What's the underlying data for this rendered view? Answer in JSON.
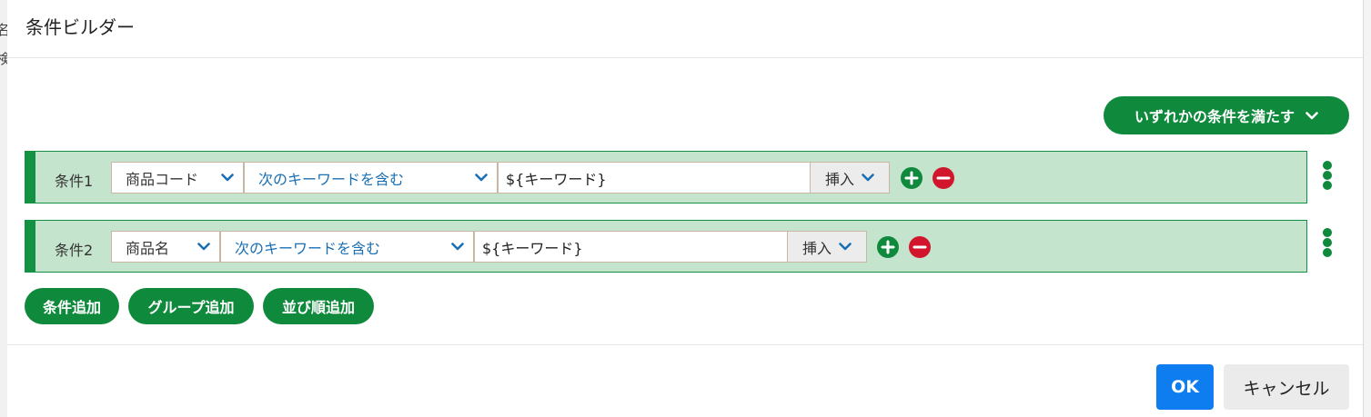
{
  "background": {
    "fragments": [
      "名",
      "検"
    ]
  },
  "dialog": {
    "title": "条件ビルダー"
  },
  "match_mode": {
    "label": "いずれかの条件を満たす"
  },
  "conditions": [
    {
      "label": "条件1",
      "field": "商品コード",
      "operator": "次のキーワードを含む",
      "value": "${キーワード}",
      "insert_label": "挿入"
    },
    {
      "label": "条件2",
      "field": "商品名",
      "operator": "次のキーワードを含む",
      "value": "${キーワード}",
      "insert_label": "挿入"
    }
  ],
  "actions": {
    "add_condition": "条件追加",
    "add_group": "グループ追加",
    "add_sort": "並び順追加"
  },
  "footer": {
    "ok": "OK",
    "cancel": "キャンセル"
  },
  "colors": {
    "green": "#0f8a3c",
    "row_bg": "#c4e4cd",
    "blue": "#0d7df0",
    "red": "#d0152c",
    "link_blue": "#1b6fb3"
  }
}
